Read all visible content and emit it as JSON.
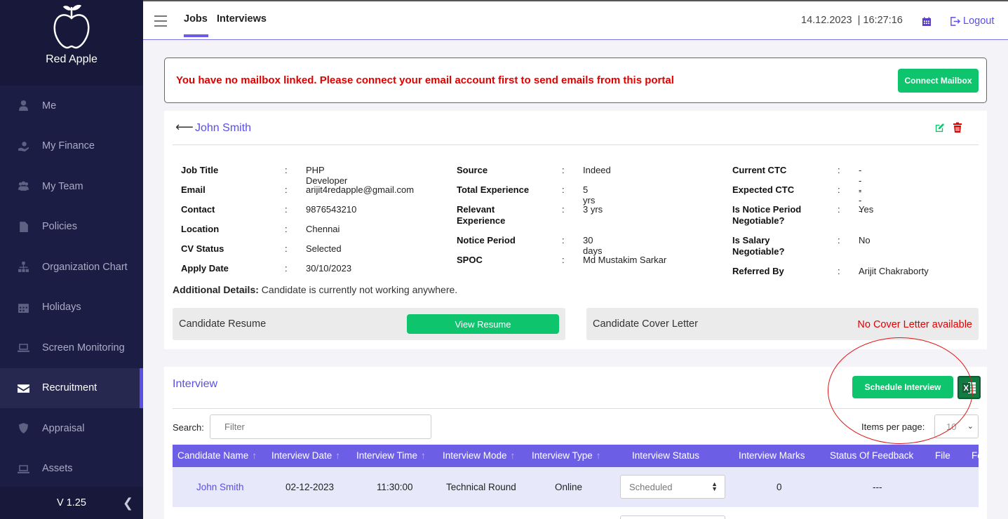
{
  "brand": {
    "name": "Red Apple"
  },
  "sidebar": {
    "items": [
      {
        "label": "Me",
        "icon": "user-icon"
      },
      {
        "label": "My Finance",
        "icon": "finance-icon"
      },
      {
        "label": "My Team",
        "icon": "team-icon"
      },
      {
        "label": "Policies",
        "icon": "document-icon"
      },
      {
        "label": "Organization Chart",
        "icon": "org-chart-icon"
      },
      {
        "label": "Holidays",
        "icon": "calendar-icon"
      },
      {
        "label": "Screen Monitoring",
        "icon": "laptop-icon"
      },
      {
        "label": "Recruitment",
        "icon": "envelope-icon",
        "active": true
      },
      {
        "label": "Appraisal",
        "icon": "shield-icon"
      },
      {
        "label": "Assets",
        "icon": "laptop-icon"
      }
    ],
    "version": "V 1.25"
  },
  "topbar": {
    "tabs": [
      "Jobs",
      "Interviews"
    ],
    "active_tab": "Jobs",
    "datetime": "14.12.2023  | 16:27:16",
    "logout": "Logout"
  },
  "alert": {
    "message": "You have no mailbox linked. Please connect your email account first to send emails from this portal",
    "button": "Connect Mailbox"
  },
  "candidate": {
    "name": "John Smith",
    "col1": [
      {
        "label": "Job Title",
        "value": "PHP Developer"
      },
      {
        "label": "Email",
        "value": "arijit4redapple@gmail.com"
      },
      {
        "label": "Contact",
        "value": "9876543210"
      },
      {
        "label": "Location",
        "value": "Chennai"
      },
      {
        "label": "CV Status",
        "value": "Selected"
      },
      {
        "label": "Apply Date",
        "value": "30/10/2023"
      }
    ],
    "col2": [
      {
        "label": "Source",
        "value": "Indeed"
      },
      {
        "label": "Total Experience",
        "value": "5 yrs"
      },
      {
        "label": "Relevant Experience",
        "value": "3 yrs"
      },
      {
        "label": "Notice Period",
        "value": "30 days"
      },
      {
        "label": "SPOC",
        "value": "Md Mustakim Sarkar"
      }
    ],
    "col3": [
      {
        "label": "Current CTC",
        "value": "---"
      },
      {
        "label": "Expected CTC",
        "value": "---"
      },
      {
        "label": "Is Notice Period Negotiable?",
        "value": "Yes"
      },
      {
        "label": "Is Salary Negotiable?",
        "value": "No"
      },
      {
        "label": "Referred By",
        "value": "Arijit Chakraborty"
      }
    ],
    "additional_label": "Additional Details:",
    "additional_value": " Candidate is currently not working anywhere.",
    "resume_label": "Candidate Resume",
    "resume_button": "View Resume",
    "cover_label": "Candidate Cover Letter",
    "cover_status": "No Cover Letter available"
  },
  "interview": {
    "title": "Interview",
    "schedule_button": "Schedule Interview",
    "search_label": "Search:",
    "search_placeholder": "Filter",
    "items_per_page_label": "Items per page:",
    "items_per_page": "10",
    "columns": [
      "Candidate Name",
      "Interview Date",
      "Interview Time",
      "Interview Mode",
      "Interview Type",
      "Interview Status",
      "Interview Marks",
      "Status Of Feedback",
      "File",
      "Fe"
    ],
    "rows": [
      {
        "candidate": "John Smith",
        "date": "02-12-2023",
        "time": "11:30:00",
        "mode": "Technical Round",
        "type": "Online",
        "status": "Scheduled",
        "marks": "0",
        "feedback": "---"
      }
    ]
  },
  "colors": {
    "accent": "#5a4ee8",
    "green": "#0ec56e",
    "sidebar": "#1c1d45",
    "alert": "#e00000"
  }
}
